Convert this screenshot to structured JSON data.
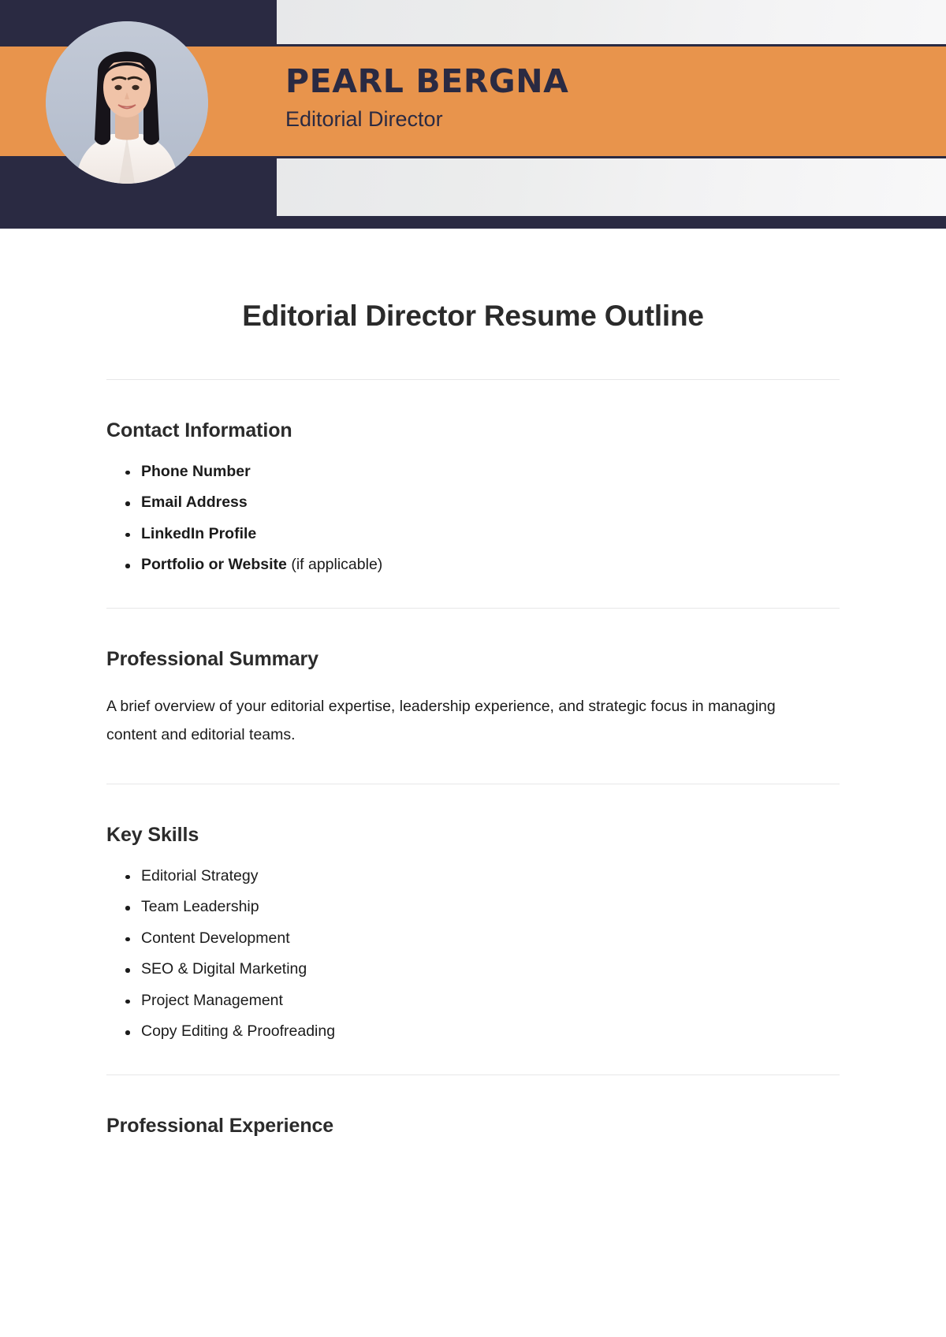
{
  "header": {
    "name": "PEARL BERGNA",
    "role": "Editorial Director",
    "avatar_alt": "profile-photo",
    "colors": {
      "navy": "#2a2a42",
      "orange": "#e8944c",
      "panel_gray": "#eceded",
      "avatar_backdrop": "#b9c1d0"
    }
  },
  "document": {
    "title": "Editorial Director Resume Outline",
    "sections": [
      {
        "heading": "Contact Information",
        "type": "bullets-bold",
        "items": [
          {
            "label": "Phone Number",
            "note": ""
          },
          {
            "label": "Email Address",
            "note": ""
          },
          {
            "label": "LinkedIn Profile",
            "note": ""
          },
          {
            "label": "Portfolio or Website",
            "note": " (if applicable)"
          }
        ]
      },
      {
        "heading": "Professional Summary",
        "type": "paragraph",
        "paragraph": "A brief overview of your editorial expertise, leadership experience, and strategic focus in managing content and editorial teams."
      },
      {
        "heading": "Key Skills",
        "type": "bullets",
        "items": [
          {
            "label": "Editorial Strategy"
          },
          {
            "label": "Team Leadership"
          },
          {
            "label": "Content Development"
          },
          {
            "label": "SEO & Digital Marketing"
          },
          {
            "label": "Project Management"
          },
          {
            "label": "Copy Editing & Proofreading"
          }
        ]
      },
      {
        "heading": "Professional Experience",
        "type": "heading-only",
        "items": []
      }
    ]
  }
}
